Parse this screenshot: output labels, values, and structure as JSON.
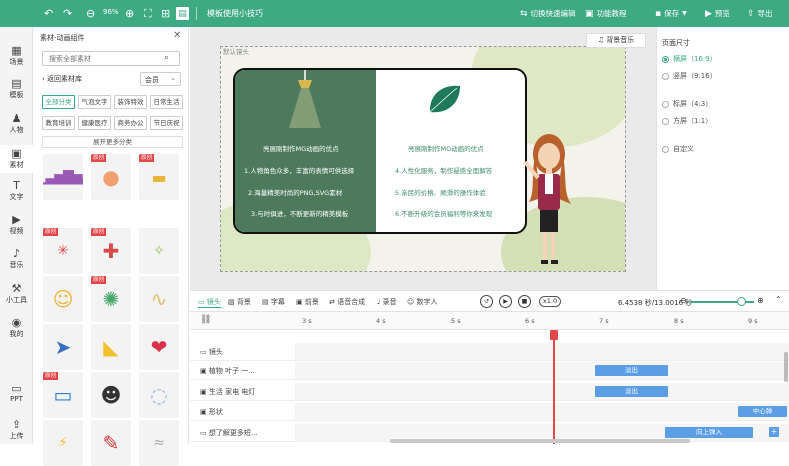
{
  "toolbar": {
    "zoom": "96%",
    "title": "模板使用小技巧",
    "switch_label": "切换快速编辑",
    "func_label": "功能教程",
    "save_label": "保存",
    "preview_label": "预览",
    "export_label": "导出"
  },
  "nav": [
    {
      "label": "场景",
      "icon": "▦"
    },
    {
      "label": "模板",
      "icon": "▤"
    },
    {
      "label": "人物",
      "icon": "♟"
    },
    {
      "label": "素材",
      "icon": "▣"
    },
    {
      "label": "文字",
      "icon": "T"
    },
    {
      "label": "视频",
      "icon": "▶"
    },
    {
      "label": "音乐",
      "icon": "♪"
    },
    {
      "label": "小工具",
      "icon": "⚒"
    },
    {
      "label": "我的",
      "icon": "◉"
    },
    {
      "label": "PPT",
      "icon": "▭"
    },
    {
      "label": "上传",
      "icon": "⇪"
    }
  ],
  "panel": {
    "title": "素材-动画组件",
    "search_placeholder": "搜索全部素材",
    "back_label": "返回素材库",
    "member_label": "会员",
    "categories": [
      "全部分类",
      "气泡文字",
      "装饰特效",
      "日常生活",
      "教育培训",
      "健康医疗",
      "商务办公",
      "节日庆祝"
    ],
    "expand_label": "展开更多分类",
    "badge_label": "原创"
  },
  "canvas": {
    "frame_label": "默认镜头",
    "bg_music_label": "背景音乐",
    "board": {
      "left_title": "亮展刚制作MG动画的优点",
      "left_lines": [
        "1.人物角色众多，丰富的表情可供选择",
        "2.海量精美时尚的PNG,SVG素材",
        "3.与时俱进，不断更新的精美模板"
      ],
      "right_title": "亮展刚制作MG动画的优点",
      "right_lines": [
        "4.人性化服务，制作疑惑全面解答",
        "5.亲民的价格、顺滑的操作体验",
        "6.不断升级的会员福利等你来发现"
      ]
    }
  },
  "size_panel": {
    "title": "页面尺寸",
    "options": [
      "横屏（16:9）",
      "竖屏（9:16）",
      "标屏（4:3）",
      "方屏（1:1）",
      "自定义"
    ]
  },
  "timeline": {
    "tabs": [
      "镜头",
      "背景",
      "字幕",
      "前景",
      "语音合成",
      "录音",
      "数字人"
    ],
    "speed": "x1.0",
    "time": "6.4538 秒/13.0016 秒",
    "progress": 0.74,
    "ruler": [
      "3 s",
      "4 s",
      "5 s",
      "6 s",
      "7 s",
      "8 s",
      "9 s"
    ],
    "rows": [
      {
        "label": "镜头",
        "clip": ""
      },
      {
        "label": "植物 叶子 一...",
        "clip": "淡出"
      },
      {
        "label": "生活 家电 电灯",
        "clip": "淡出"
      },
      {
        "label": "形状",
        "clip": "中心弹"
      },
      {
        "label": "想了解更多短...",
        "clip": "向上弹入"
      }
    ]
  }
}
